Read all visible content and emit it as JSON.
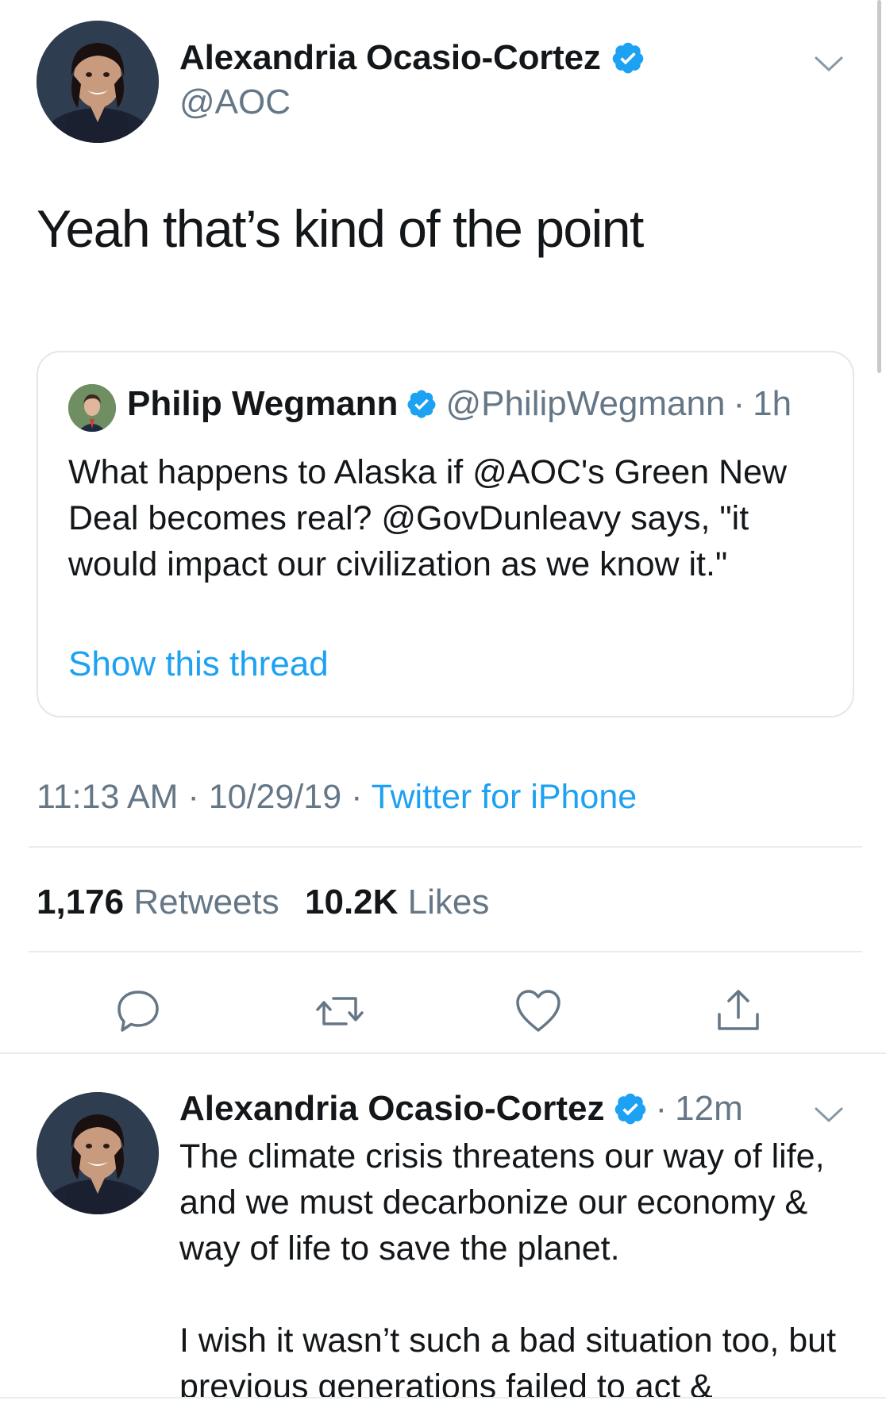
{
  "main_tweet": {
    "author_name": "Alexandria Ocasio-Cortez",
    "author_handle": "@AOC",
    "text": "Yeah that’s kind of the point",
    "avatar_icon": "profile-photo",
    "verified_icon": "verified-badge-icon",
    "menu_icon": "chevron-down-icon"
  },
  "quoted_tweet": {
    "author_name": "Philip Wegmann",
    "author_handle": "@PhilipWegmann",
    "separator": "·",
    "age": "1h",
    "text": "What happens to Alaska if @AOC's Green New Deal becomes real? @GovDunleavy says, \"it would impact our civilization as we know it.\"",
    "show_thread": "Show this thread"
  },
  "meta": {
    "time": "11:13 AM",
    "separator1": "·",
    "date": "10/29/19",
    "separator2": "·",
    "source": "Twitter for iPhone"
  },
  "stats": {
    "retweets_count": "1,176",
    "retweets_label": "Retweets",
    "likes_count": "10.2K",
    "likes_label": "Likes"
  },
  "actions": {
    "reply_icon": "reply-icon",
    "retweet_icon": "retweet-icon",
    "like_icon": "heart-icon",
    "share_icon": "share-icon"
  },
  "reply_tweet": {
    "author_name": "Alexandria Ocasio-Cortez",
    "separator": "·",
    "age": "12m",
    "paragraph1": "The climate crisis threatens our way of life, and we must decarbonize our economy & way of life to save the planet.",
    "paragraph2": "I wish it wasn’t such a bad situation too, but previous generations failed to act &"
  },
  "colors": {
    "accent": "#1da1f2",
    "secondary_text": "#657786",
    "primary_text": "#14171a",
    "border": "#e1e8ed"
  }
}
